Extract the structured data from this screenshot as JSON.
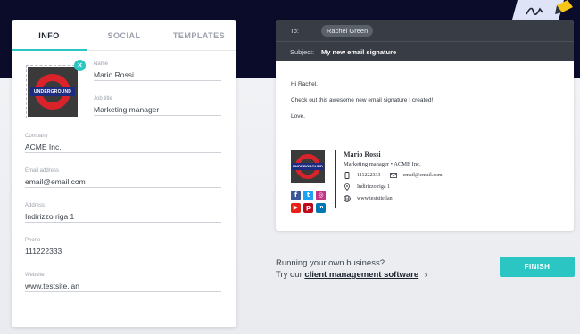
{
  "tabs": [
    "INFO",
    "SOCIAL",
    "TEMPLATES"
  ],
  "active_tab": 0,
  "photo": {
    "caption": "UNDERGROUND"
  },
  "fields": {
    "name": {
      "label": "Name",
      "value": "Mario Rossi"
    },
    "job_title": {
      "label": "Job title",
      "value": "Marketing manager"
    },
    "company": {
      "label": "Company",
      "value": "ACME Inc."
    },
    "email": {
      "label": "Email address",
      "value": "email@email.com"
    },
    "address": {
      "label": "Address",
      "value": "Indirizzo riga 1"
    },
    "phone": {
      "label": "Phone",
      "value": "111222333"
    },
    "website": {
      "label": "Website",
      "value": "www.testsite.lan"
    }
  },
  "email": {
    "to_label": "To:",
    "to_value": "Rachel Green",
    "subject_label": "Subject:",
    "subject_value": "My new email signature",
    "greeting": "Hi Rachel,",
    "body": "Check out this awesome new email signature I created!",
    "closing": "Love,"
  },
  "signature": {
    "name": "Mario Rossi",
    "role_line": "Marketing manager • ACME Inc.",
    "phone": "111222333",
    "email": "email@email.com",
    "address": "Indirizzo riga 1",
    "website": "www.testsite.lan",
    "social": [
      {
        "icon": "facebook-icon",
        "glyph": "f",
        "color": "#3b5998"
      },
      {
        "icon": "twitter-icon",
        "glyph": "t",
        "color": "#1da1f2"
      },
      {
        "icon": "instagram-icon",
        "glyph": "◎",
        "color": "#c13584"
      },
      {
        "icon": "youtube-icon",
        "glyph": "▶",
        "color": "#e62117"
      },
      {
        "icon": "pinterest-icon",
        "glyph": "p",
        "color": "#bd081c"
      },
      {
        "icon": "linkedin-icon",
        "glyph": "in",
        "color": "#0077b5"
      }
    ]
  },
  "promo": {
    "line1": "Running your own business?",
    "line2_prefix": "Try our",
    "link": "client management software",
    "chevron": "›"
  },
  "finish_label": "FINISH",
  "colors": {
    "accent": "#2bc6c4",
    "header_dark": "#0b0c2a",
    "mail_header": "#383c44"
  }
}
